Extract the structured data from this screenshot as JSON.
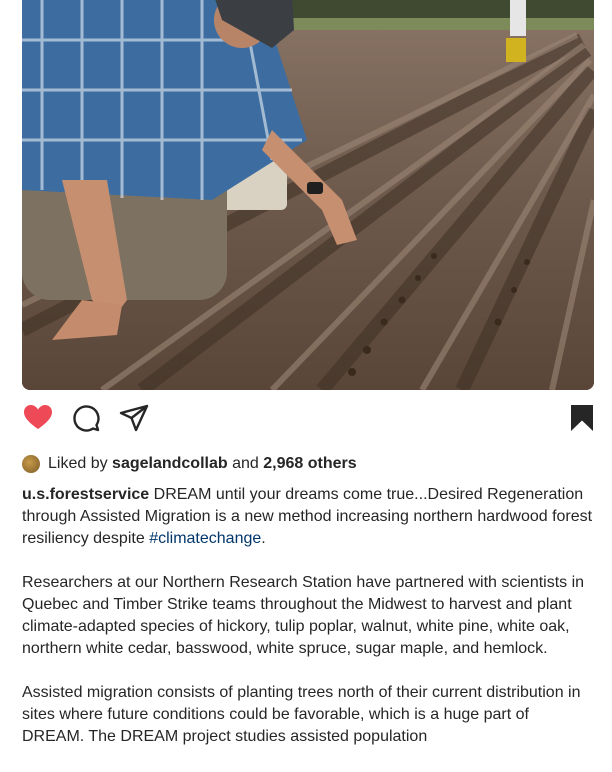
{
  "actions": {
    "like_icon": "heart-filled-icon",
    "comment_icon": "comment-icon",
    "share_icon": "share-icon",
    "save_icon": "bookmark-filled-icon",
    "like_color": "#ed4956",
    "ink_color": "#262626"
  },
  "likes": {
    "prefix": "Liked by",
    "user": "sagelandcollab",
    "joiner": "and",
    "others": "2,968 others"
  },
  "caption": {
    "username": "u.s.forestservice",
    "p1_text": "DREAM until your dreams come true...Desired Regeneration through Assisted Migration is a new method increasing northern hardwood forest resiliency despite",
    "p1_hashtag": "#climatechange",
    "p1_end": ".",
    "p2": "Researchers at our Northern Research Station have partnered with scientists in Quebec and Timber Strike teams throughout the Midwest to harvest and plant climate-adapted species of hickory, tulip poplar, walnut, white pine, white oak, northern white cedar, basswood, white spruce, sugar maple, and hemlock.",
    "p3": "Assisted migration consists of planting trees north of their current distribution in sites where future conditions could be favorable, which is a huge part of DREAM. The DREAM project studies assisted population"
  }
}
